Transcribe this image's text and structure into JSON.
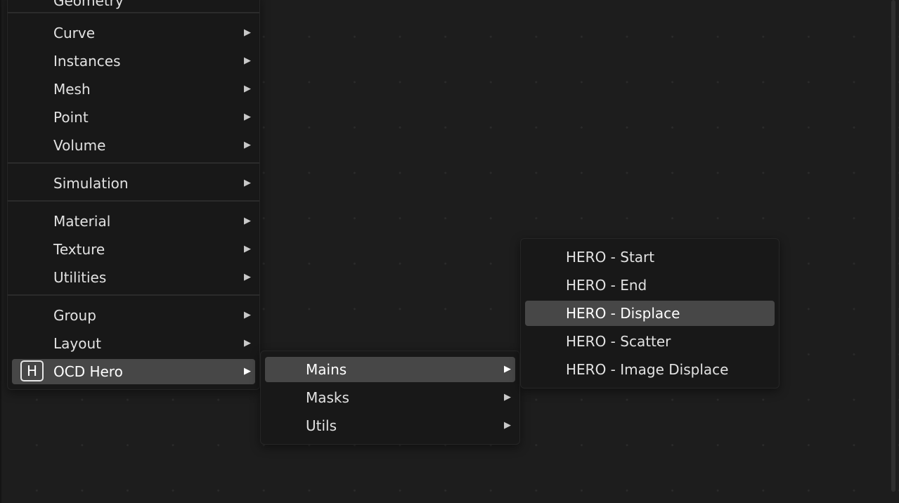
{
  "main_menu": {
    "cut_item": "Geometry",
    "items": [
      {
        "label": "Curve",
        "arrow": "▶"
      },
      {
        "label": "Instances",
        "arrow": "▶"
      },
      {
        "label": "Mesh",
        "arrow": "▶"
      },
      {
        "label": "Point",
        "arrow": "▶"
      },
      {
        "label": "Volume",
        "arrow": "▶"
      },
      {
        "label": "Simulation",
        "arrow": "▶"
      },
      {
        "label": "Material",
        "arrow": "▶"
      },
      {
        "label": "Texture",
        "arrow": "▶"
      },
      {
        "label": "Utilities",
        "arrow": "▶"
      },
      {
        "label": "Group",
        "arrow": "▶"
      },
      {
        "label": "Layout",
        "arrow": "▶"
      },
      {
        "label": "OCD Hero",
        "arrow": "▶",
        "icon_letter": "H",
        "icon": "hero-addon-icon"
      }
    ]
  },
  "submenu_ocd_hero": {
    "items": [
      {
        "label": "Mains",
        "arrow": "▶"
      },
      {
        "label": "Masks",
        "arrow": "▶"
      },
      {
        "label": "Utils",
        "arrow": "▶"
      }
    ]
  },
  "submenu_mains": {
    "items": [
      {
        "label": "HERO - Start"
      },
      {
        "label": "HERO - End"
      },
      {
        "label": "HERO - Displace"
      },
      {
        "label": "HERO - Scatter"
      },
      {
        "label": "HERO - Image Displace"
      }
    ]
  },
  "colors": {
    "background": "#1d1d1d",
    "menu_background": "#181818",
    "highlight": "#474747",
    "text": "#e2e2e2"
  }
}
